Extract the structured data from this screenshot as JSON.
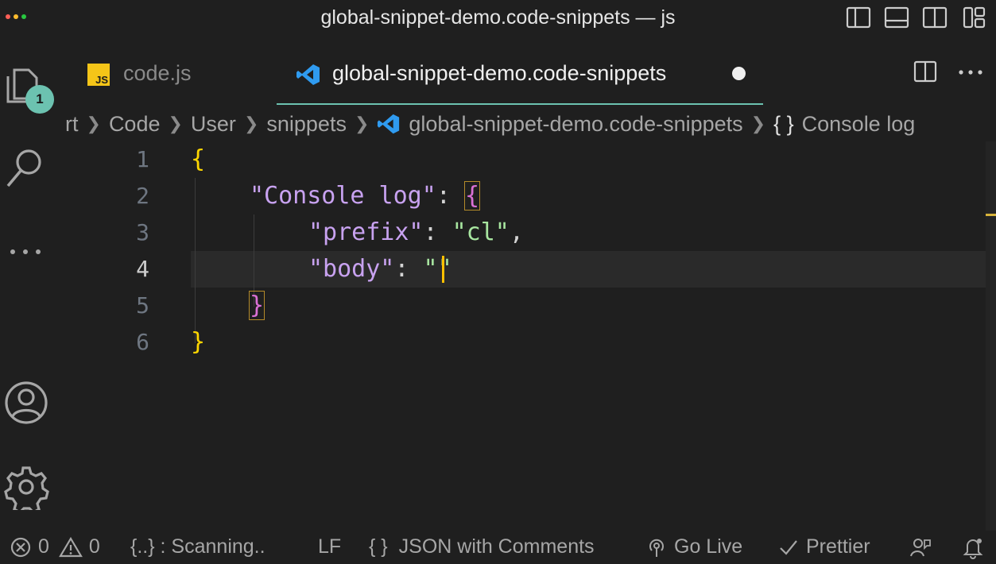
{
  "window": {
    "title": "global-snippet-demo.code-snippets — js",
    "traffic_colors": [
      "#ff5f57",
      "#febc2e",
      "#28c840"
    ]
  },
  "activity_bar": {
    "explorer_badge": "1",
    "items": [
      "explorer-icon",
      "search-icon",
      "more-icon",
      "account-icon",
      "settings-gear-icon"
    ]
  },
  "tabs": [
    {
      "icon_text": "JS",
      "label": "code.js",
      "active": false
    },
    {
      "label": "global-snippet-demo.code-snippets",
      "active": true,
      "dirty": true
    }
  ],
  "breadcrumb": {
    "items": [
      "rt",
      "Code",
      "User",
      "snippets",
      "global-snippet-demo.code-snippets",
      "{ }",
      "Console log"
    ]
  },
  "editor": {
    "line_numbers": [
      "1",
      "2",
      "3",
      "4",
      "5",
      "6"
    ],
    "current_line": 4,
    "tokens": {
      "l1_open": "{",
      "l2_key": "\"Console log\"",
      "l2_colon": ": ",
      "l2_open": "{",
      "l3_key": "\"prefix\"",
      "l3_colon": ": ",
      "l3_val": "\"cl\"",
      "l3_comma": ",",
      "l4_key": "\"body\"",
      "l4_colon": ": ",
      "l4_q1": "\"",
      "l4_q2": "\"",
      "l5_close": "}",
      "l6_close": "}"
    }
  },
  "status_bar": {
    "errors": "0",
    "warnings": "0",
    "scanning": "{..} : Scanning..",
    "eol": "LF",
    "language_icon": "{ }",
    "language": "JSON with Comments",
    "go_live": "Go Live",
    "prettier": "Prettier"
  },
  "colors": {
    "accent": "#6cc2b0",
    "js_badge": "#f5c518",
    "vscode_blue": "#2f9bf0"
  }
}
